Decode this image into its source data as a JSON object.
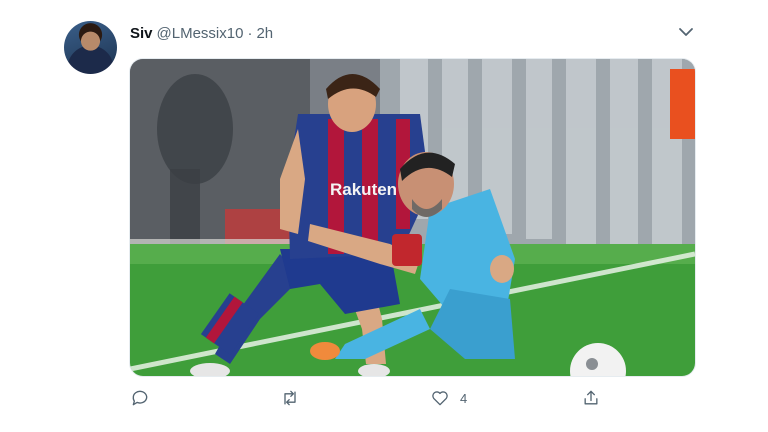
{
  "tweet": {
    "author_name": "Siv",
    "handle": "@LMessix10",
    "separator": "·",
    "time": "2h",
    "jersey_text": "Rakuten",
    "actions": {
      "reply_count": "",
      "retweet_count": "",
      "like_count": "4"
    }
  },
  "icons": [
    "reply-icon",
    "retweet-icon",
    "like-icon",
    "share-icon",
    "chevron-down-icon"
  ],
  "colors": {
    "text": "#0f1419",
    "secondary": "#536471",
    "pitch_green": "#3f9e3a",
    "barca_blue": "#27408f",
    "barca_red": "#b2163b",
    "opponent_cyan": "#49b4e2"
  }
}
